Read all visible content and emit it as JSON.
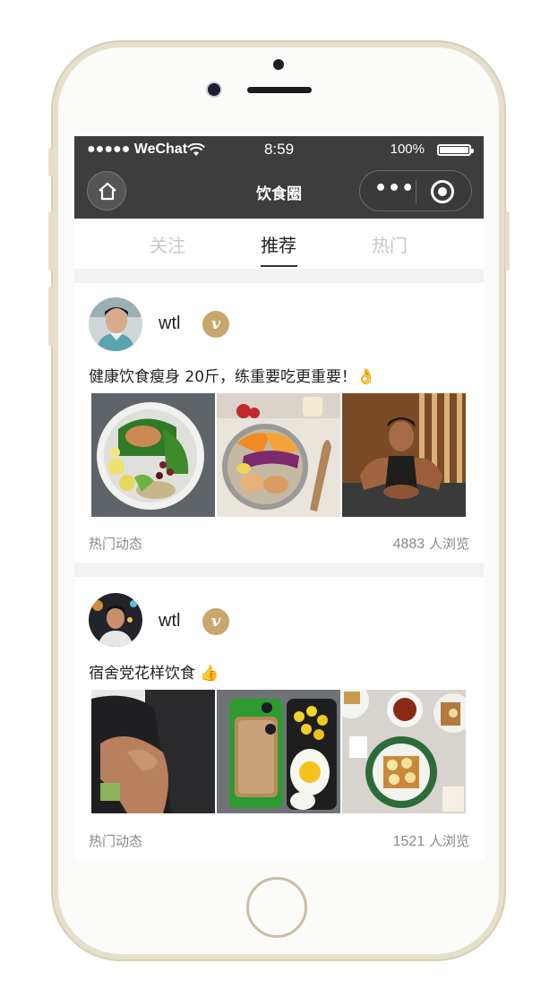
{
  "statusbar": {
    "signal": "●●●●● WeChat",
    "time": "8:59",
    "battery_text": "100%"
  },
  "navbar": {
    "title": "饮食圈",
    "home_icon": "home-icon",
    "more_icon": "more-dots-icon",
    "close_icon": "target-circle-icon",
    "more_label": "•••"
  },
  "tabs": [
    {
      "label": "关注",
      "active": false
    },
    {
      "label": "推荐",
      "active": true
    },
    {
      "label": "热门",
      "active": false
    }
  ],
  "posts": [
    {
      "username": "wtl",
      "badge": "v",
      "text": "健康饮食瘦身 20斤，练重要吃更重要！👌",
      "tag": "热门动态",
      "views_count": "4883",
      "views_unit": "人浏览",
      "photos": [
        "salad-bowl-photo",
        "grain-bowl-photo",
        "plank-exercise-photo"
      ]
    },
    {
      "username": "wtl",
      "badge": "v",
      "text": "宿舍党花样饮食 👍",
      "tag": "热门动态",
      "views_count": "1521",
      "views_unit": "人浏览",
      "photos": [
        "arm-muscle-photo",
        "bento-box-photo",
        "banana-toast-photo"
      ]
    }
  ]
}
